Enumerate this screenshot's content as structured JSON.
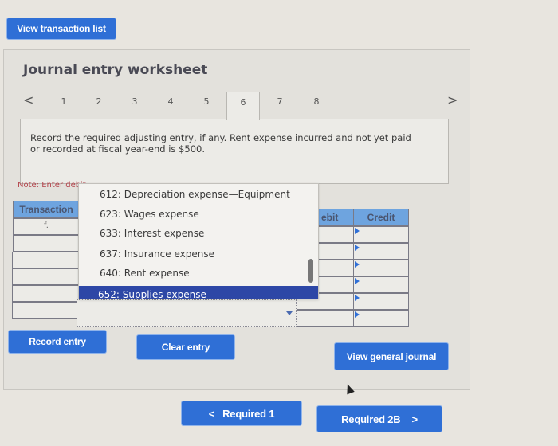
{
  "top": {
    "view_transaction_list": "View transaction list"
  },
  "worksheet": {
    "title": "Journal entry worksheet",
    "tabs": [
      "1",
      "2",
      "3",
      "4",
      "5",
      "6",
      "7",
      "8"
    ],
    "active_tab": "6",
    "prev_icon": "<",
    "next_icon": ">",
    "question": "Record the required adjusting entry, if any. Rent expense incurred and not yet paid or recorded at fiscal year-end is $500.",
    "note": "Note: Enter debit"
  },
  "table": {
    "headers": {
      "transaction": "Transaction",
      "debit": "ebit",
      "credit": "Credit"
    },
    "rows": [
      {
        "transaction": "f.",
        "account": "",
        "debit": "",
        "credit": ""
      },
      {
        "transaction": "",
        "account": "",
        "debit": "",
        "credit": ""
      },
      {
        "transaction": "",
        "account": "",
        "debit": "",
        "credit": ""
      },
      {
        "transaction": "",
        "account": "",
        "debit": "",
        "credit": ""
      },
      {
        "transaction": "",
        "account": "",
        "debit": "",
        "credit": ""
      },
      {
        "transaction": "",
        "account": "",
        "debit": "",
        "credit": ""
      }
    ]
  },
  "dropdown": {
    "options": [
      "612: Depreciation expense—Equipment",
      "623: Wages expense",
      "633: Interest expense",
      "637: Insurance expense",
      "640: Rent expense",
      "652: Supplies expense"
    ],
    "highlighted": "652: Supplies expense"
  },
  "actions": {
    "record_entry": "Record entry",
    "clear_entry": "Clear entry",
    "view_general_journal": "View general journal"
  },
  "nav": {
    "prev_label": "Required 1",
    "prev_icon": "<",
    "next_label": "Required 2B",
    "next_icon": ">"
  }
}
